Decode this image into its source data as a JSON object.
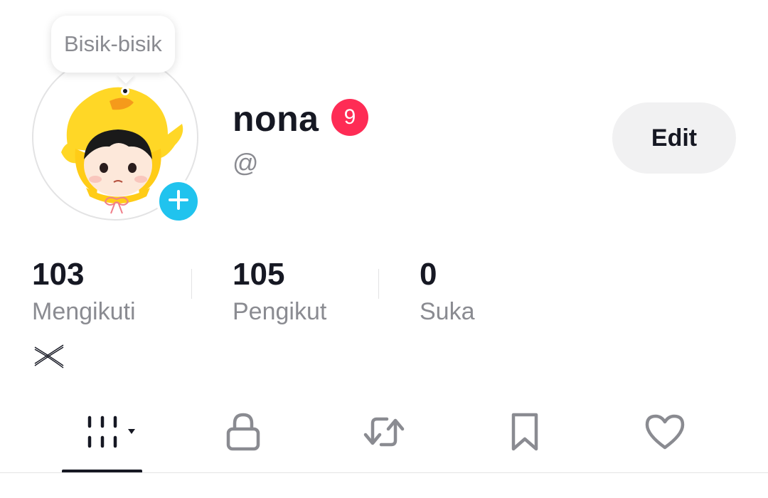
{
  "bubble": {
    "text": "Bisik-bisik"
  },
  "profile": {
    "name": "nona",
    "notification_count": "9",
    "handle": "@",
    "edit_label": "Edit"
  },
  "stats": [
    {
      "value": "103",
      "label": "Mengikuti"
    },
    {
      "value": "105",
      "label": "Pengikut"
    },
    {
      "value": "0",
      "label": "Suka"
    }
  ],
  "tabs": [
    {
      "icon": "grid-icon",
      "active": true
    },
    {
      "icon": "lock-icon",
      "active": false
    },
    {
      "icon": "repost-icon",
      "active": false
    },
    {
      "icon": "bookmark-icon",
      "active": false
    },
    {
      "icon": "heart-icon",
      "active": false
    }
  ],
  "colors": {
    "accent_red": "#fe2c55",
    "add_blue": "#20c3ee",
    "text_primary": "#161823",
    "text_secondary": "#8a8b91",
    "button_bg": "#f1f1f2"
  }
}
